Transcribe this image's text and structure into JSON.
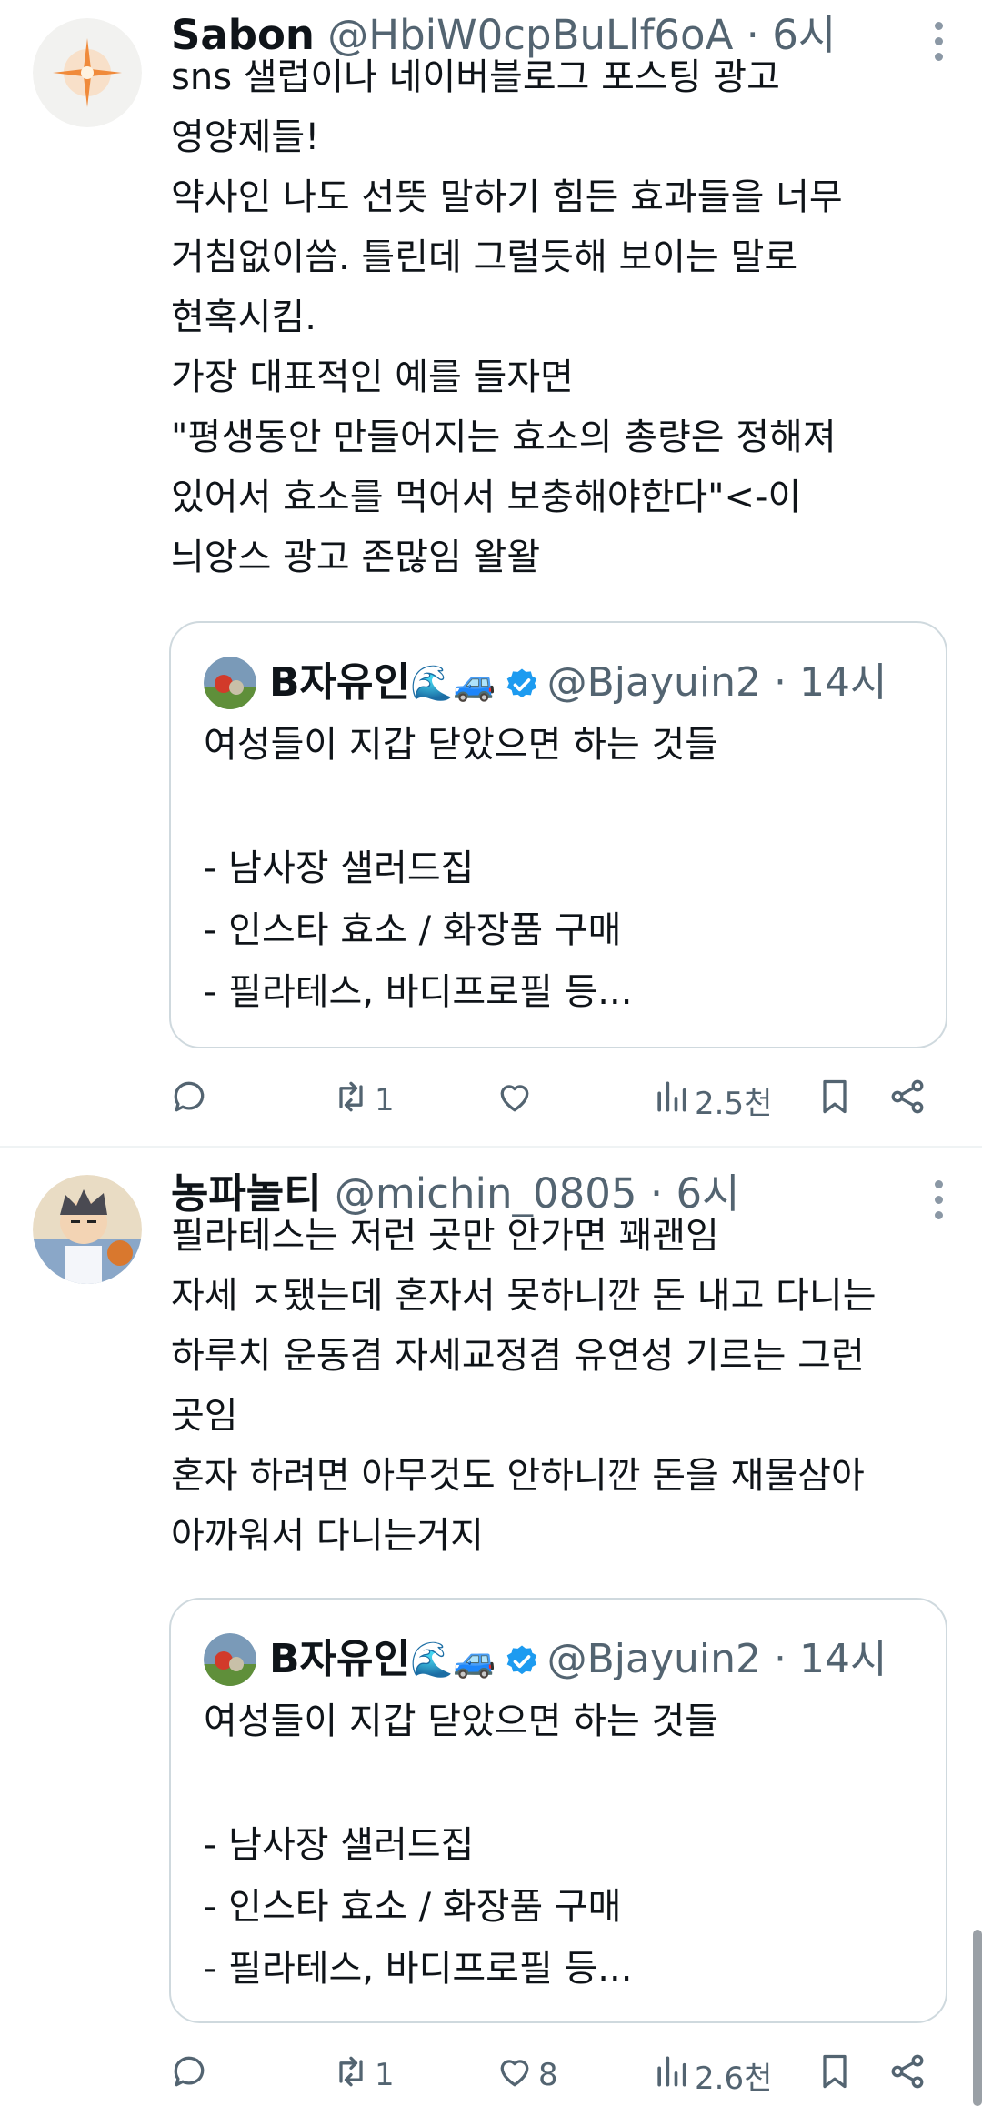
{
  "tweets": [
    {
      "display_name": "Sabon",
      "handle": "@HbiW0cpBuLlf6oA",
      "separator": "·",
      "time": "6시",
      "text": "sns 샐럽이나 네이버블로그 포스팅 광고\n영양제들!\n약사인 나도 선뜻 말하기 힘든 효과들을 너무\n거침없이씀. 틀린데 그럴듯해 보이는 말로\n현혹시킴.\n가장 대표적인 예를 들자면\n\"평생동안 만들어지는 효소의 총량은 정해져\n있어서 효소를 먹어서 보충해야한다\"<-이\n늬앙스 광고 존많임 왈왈",
      "quote": {
        "display_name": "B자유인",
        "emoji": "🌊🚙",
        "handle": "@Bjayuin2",
        "separator": "·",
        "time": "14시",
        "text": "여성들이 지갑 닫았으면 하는 것들\n\n- 남사장 샐러드집\n- 인스타 효소 / 화장품 구매\n- 필라테스, 바디프로필 등..."
      },
      "actions": {
        "reply": "",
        "retweet": "1",
        "like": "",
        "views": "2.5천"
      }
    },
    {
      "display_name": "농파놀티",
      "handle": "@michin_0805",
      "separator": "·",
      "time": "6시",
      "text": "필라테스는 저런 곳만 안가면 꽤괜임\n자세 ㅈ됐는데 혼자서 못하니깐 돈 내고 다니는\n하루치 운동겸 자세교정겸 유연성 기르는 그런\n곳임\n혼자 하려면 아무것도 안하니깐 돈을 재물삼아\n아까워서 다니는거지",
      "quote": {
        "display_name": "B자유인",
        "emoji": "🌊🚙",
        "handle": "@Bjayuin2",
        "separator": "·",
        "time": "14시",
        "text": "여성들이 지갑 닫았으면 하는 것들\n\n- 남사장 샐러드집\n- 인스타 효소 / 화장품 구매\n- 필라테스, 바디프로필 등..."
      },
      "actions": {
        "reply": "",
        "retweet": "1",
        "like": "8",
        "views": "2.6천"
      }
    }
  ],
  "colors": {
    "text": "#0f1419",
    "secondary": "#536471",
    "border": "#cfd9de",
    "verified": "#1d9bf0"
  },
  "icons": [
    "more-vertical-icon",
    "verified-icon",
    "reply-icon",
    "retweet-icon",
    "like-icon",
    "views-icon",
    "bookmark-icon",
    "share-icon"
  ]
}
